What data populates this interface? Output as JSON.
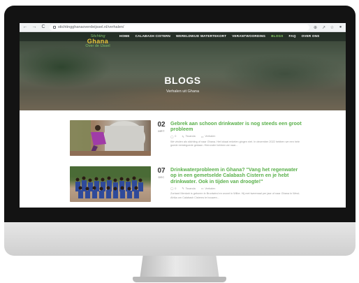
{
  "browser": {
    "url": "stichtingghanaoverdeijssel.nl/verhalen/",
    "back_glyph": "←",
    "forward_glyph": "→",
    "reload_glyph": "C",
    "zoom_glyph": "⊕",
    "share_glyph": "↗",
    "star_glyph": "☆",
    "profile_glyph": "●"
  },
  "logo": {
    "line1": "Stichting",
    "line2": "Ghana",
    "line3": "Over de IJssel"
  },
  "nav": {
    "items": [
      {
        "label": "HOME"
      },
      {
        "label": "CALABASH CISTERN"
      },
      {
        "label": "WERELDWIJD WATERTEKORT"
      },
      {
        "label": "VERANTWOORDING"
      },
      {
        "label": "BLOGS"
      },
      {
        "label": "FAQ"
      },
      {
        "label": "OVER ONS"
      }
    ],
    "active_index": 4
  },
  "hero": {
    "title": "BLOGS",
    "subtitle": "Verhalen uit Ghana"
  },
  "posts": [
    {
      "day": "02",
      "month": "MRT",
      "title": "Gebrek aan schoon drinkwater is nog steeds een groot probleem",
      "comments": "0",
      "author": "Tsvanda",
      "category": "Verhalen",
      "excerpt": "We vinden als stichting of naar Ghana. Het lokaal enkelen gingen niet. In december 2022 hebben we een hele goede eerstegoede gedaan. Hieronder hebben we naar..."
    },
    {
      "day": "07",
      "month": "DEC",
      "title": "Drinkwaterprobleem in Ghana? \"Vang het regenwater op in een gemetselde Calabash Cistern en je hebt drinkwater. Ook in tijden van droogte!\"",
      "comments": "0",
      "author": "Tsvanda",
      "category": "Verhalen",
      "excerpt": "Zorbard Menkah is geboren in Bruntwind en woont in Wilbe. Hij met tweemaal per jaar of naar Ghana in West-Afrika om Calabash Cisterns te bouwen..."
    }
  ],
  "colors": {
    "accent_green": "#59b04a",
    "nav_active": "#8bd06a",
    "logo_gold": "#e8c33a"
  }
}
